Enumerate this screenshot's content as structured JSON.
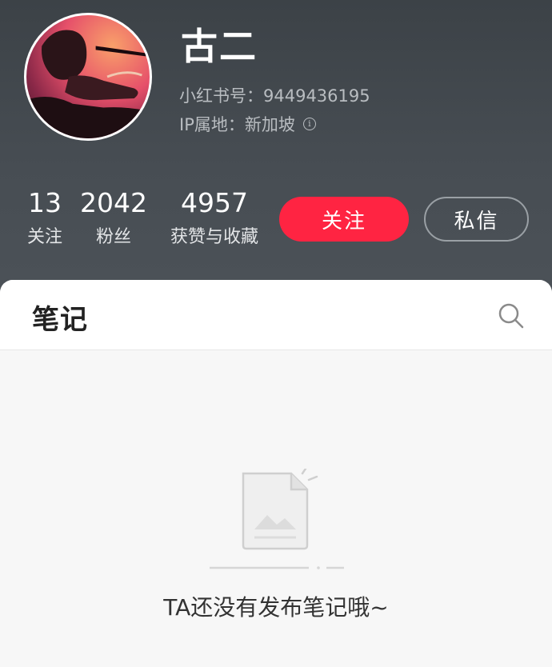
{
  "profile": {
    "nickname": "古二",
    "red_id": "小红书号：9449436195",
    "ip_location": "IP属地：新加坡",
    "avatar_icon": "avatar-image"
  },
  "stats": [
    {
      "value": "13",
      "label": "关注"
    },
    {
      "value": "2042",
      "label": "粉丝"
    },
    {
      "value": "4957",
      "label": "获赞与收藏"
    }
  ],
  "actions": {
    "follow_label": "关注",
    "message_label": "私信"
  },
  "notes_panel": {
    "tab_label": "笔记",
    "search_icon": "search-icon",
    "empty_text": "TA还没有发布笔记哦~"
  },
  "colors": {
    "accent": "#ff2442",
    "header_bg": "#43494f"
  }
}
